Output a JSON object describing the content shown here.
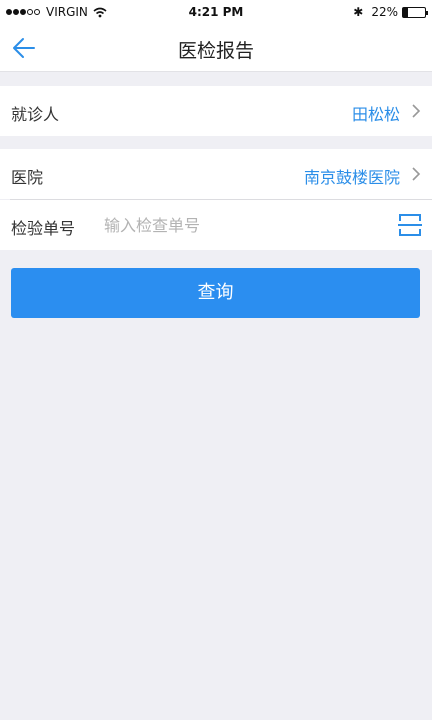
{
  "status": {
    "carrier": "VIRGIN",
    "time": "4:21 PM",
    "battery": "22%",
    "battery_level": 0.22,
    "icons": [
      "signal-dots-icon",
      "wifi-icon",
      "bluetooth-icon",
      "battery-icon"
    ]
  },
  "nav": {
    "title": "医检报告",
    "back_icon": "back-arrow-icon"
  },
  "form": {
    "patient_label": "就诊人",
    "patient_value": "田松松",
    "hospital_label": "医院",
    "hospital_value": "南京鼓楼医院",
    "report_no_label": "检验单号",
    "report_no_placeholder": "输入检查单号",
    "report_no_value": "",
    "scan_icon": "scan-icon"
  },
  "actions": {
    "query_label": "查询"
  },
  "colors": {
    "accent": "#2b8ef0",
    "link": "#2b8ee8",
    "background": "#efeff4"
  }
}
